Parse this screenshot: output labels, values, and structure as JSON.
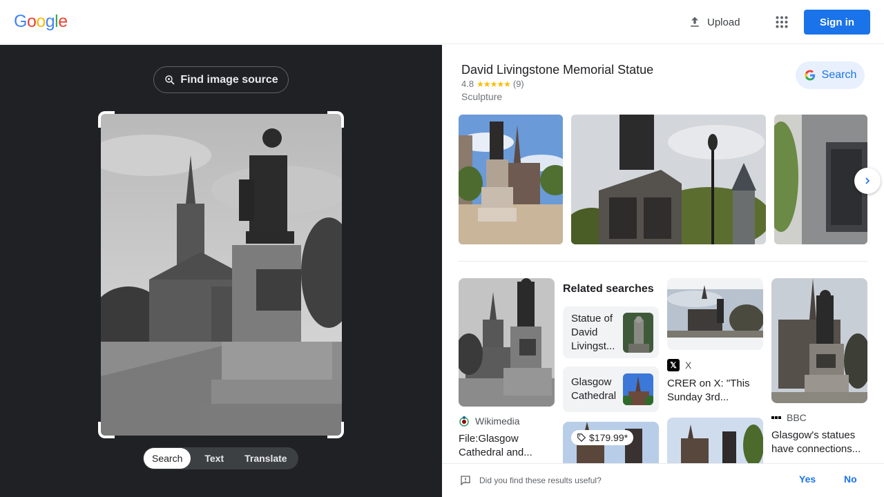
{
  "header": {
    "logo": [
      "G",
      "o",
      "o",
      "g",
      "l",
      "e"
    ],
    "logo_colors": [
      "#4285f4",
      "#ea4335",
      "#fbbc05",
      "#4285f4",
      "#34a853",
      "#ea4335"
    ],
    "upload_label": "Upload",
    "signin_label": "Sign in"
  },
  "lens": {
    "find_source_label": "Find image source",
    "tabs": [
      {
        "label": "Search",
        "active": true
      },
      {
        "label": "Text",
        "active": false
      },
      {
        "label": "Translate",
        "active": false
      }
    ]
  },
  "knowledge": {
    "title": "David Livingstone Memorial Statue",
    "rating": "4.8",
    "stars": "★★★★★",
    "review_count": "(9)",
    "type": "Sculpture",
    "search_label": "Search"
  },
  "related": {
    "title": "Related searches",
    "items": [
      {
        "label": "Statue of David Livingst..."
      },
      {
        "label": "Glasgow Cathedral"
      }
    ]
  },
  "results": [
    {
      "source": "Wikimedia",
      "title": "File:Glasgow Cathedral and..."
    },
    {
      "source": "X",
      "title": "CRER on X: \"This Sunday 3rd..."
    },
    {
      "source": "BBC",
      "title": "Glasgow's statues have connections..."
    },
    {
      "price": "$179.99*"
    }
  ],
  "feedback": {
    "question": "Did you find these results useful?",
    "yes": "Yes",
    "no": "No"
  },
  "colors": {
    "accent": "#1a73e8",
    "dark_panel": "#202124",
    "star": "#fbbc04"
  }
}
